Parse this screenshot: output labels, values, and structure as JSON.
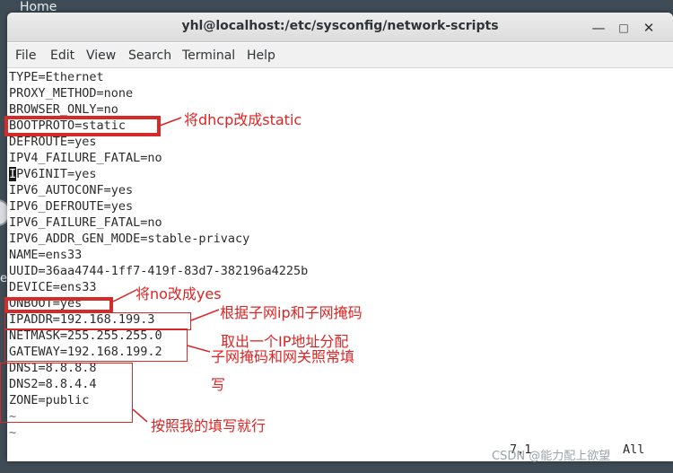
{
  "desktop": {
    "home_label": "Home",
    "edge_label": "er"
  },
  "window": {
    "title": "yhl@localhost:/etc/sysconfig/network-scripts",
    "minimize_glyph": "—",
    "maximize_glyph": "□",
    "close_glyph": "✕"
  },
  "menu": [
    "File",
    "Edit",
    "View",
    "Search",
    "Terminal",
    "Help"
  ],
  "editor": {
    "lines": [
      "TYPE=Ethernet",
      "PROXY_METHOD=none",
      "BROWSER_ONLY=no",
      "BOOTPROTO=static",
      "DEFROUTE=yes",
      "IPV4_FAILURE_FATAL=no",
      "PV6INIT=yes",
      "IPV6_AUTOCONF=yes",
      "IPV6_DEFROUTE=yes",
      "IPV6_FAILURE_FATAL=no",
      "IPV6_ADDR_GEN_MODE=stable-privacy",
      "NAME=ens33",
      "UUID=36aa4744-1ff7-419f-83d7-382196a4225b",
      "DEVICE=ens33",
      "ONBOOT=yes",
      "IPADDR=192.168.199.3",
      "NETMASK=255.255.255.0",
      "GATEWAY=192.168.199.2",
      "DNS1=8.8.8.8",
      "DNS2=8.8.4.4",
      "ZONE=public",
      "~",
      "~"
    ],
    "cursor_char": "I",
    "cursor_line_index": 6,
    "status_position": "7,1",
    "status_scroll": "All"
  },
  "annotations": {
    "bootproto_note": "将dhcp改成static",
    "onboot_note": "将no改成yes",
    "ip_note": "根据子网ip和子网掩码",
    "ip_note2": "取出一个IP地址分配",
    "gateway_note_line1": "子网掩码和网关照常填",
    "gateway_note_line2": "写",
    "dns_note": "按照我的填写就行",
    "color": "#dc2424"
  },
  "watermark": "CSDN @能力配上欲望"
}
